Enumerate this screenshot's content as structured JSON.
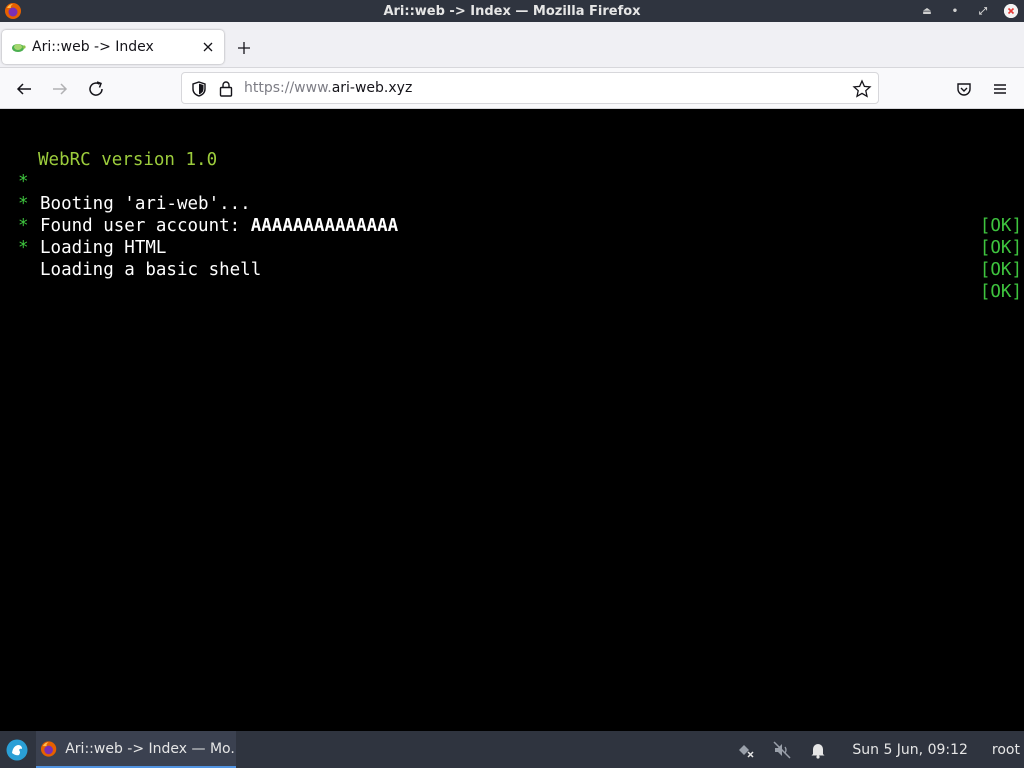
{
  "window": {
    "title": "Ari::web -> Index — Mozilla Firefox"
  },
  "tabs": [
    {
      "label": "Ari::web -> Index"
    }
  ],
  "urlbar": {
    "prefix": "https://www.",
    "domain": "ari-web.xyz"
  },
  "terminal": {
    "version": "WebRC version 1.0",
    "lines": [
      {
        "bullet": "*",
        "text": "Booting 'ari-web'...",
        "bold": "",
        "status": "[OK]"
      },
      {
        "bullet": "*",
        "text": "Found user account: ",
        "bold": "AAAAAAAAAAAAAA",
        "status": "[OK]"
      },
      {
        "bullet": "*",
        "text": "Loading HTML",
        "bold": "",
        "status": "[OK]"
      },
      {
        "bullet": "*",
        "text": "Loading a basic shell",
        "bold": "",
        "status": "[OK]"
      }
    ]
  },
  "taskbar": {
    "task_label": "Ari::web -> Index — Mo...",
    "clock": "Sun  5 Jun, 09:12",
    "user": "root"
  },
  "colors": {
    "terminal_green": "#3ec43e",
    "version_green": "#9ccc3c",
    "panel": "#2f343f"
  },
  "icons": [
    "firefox-icon",
    "close-icon",
    "plus-icon",
    "back-arrow-icon",
    "forward-arrow-icon",
    "reload-icon",
    "shield-icon",
    "lock-icon",
    "star-icon",
    "pocket-icon",
    "menu-icon",
    "start-menu-icon",
    "network-icon",
    "mute-icon",
    "bell-icon"
  ]
}
